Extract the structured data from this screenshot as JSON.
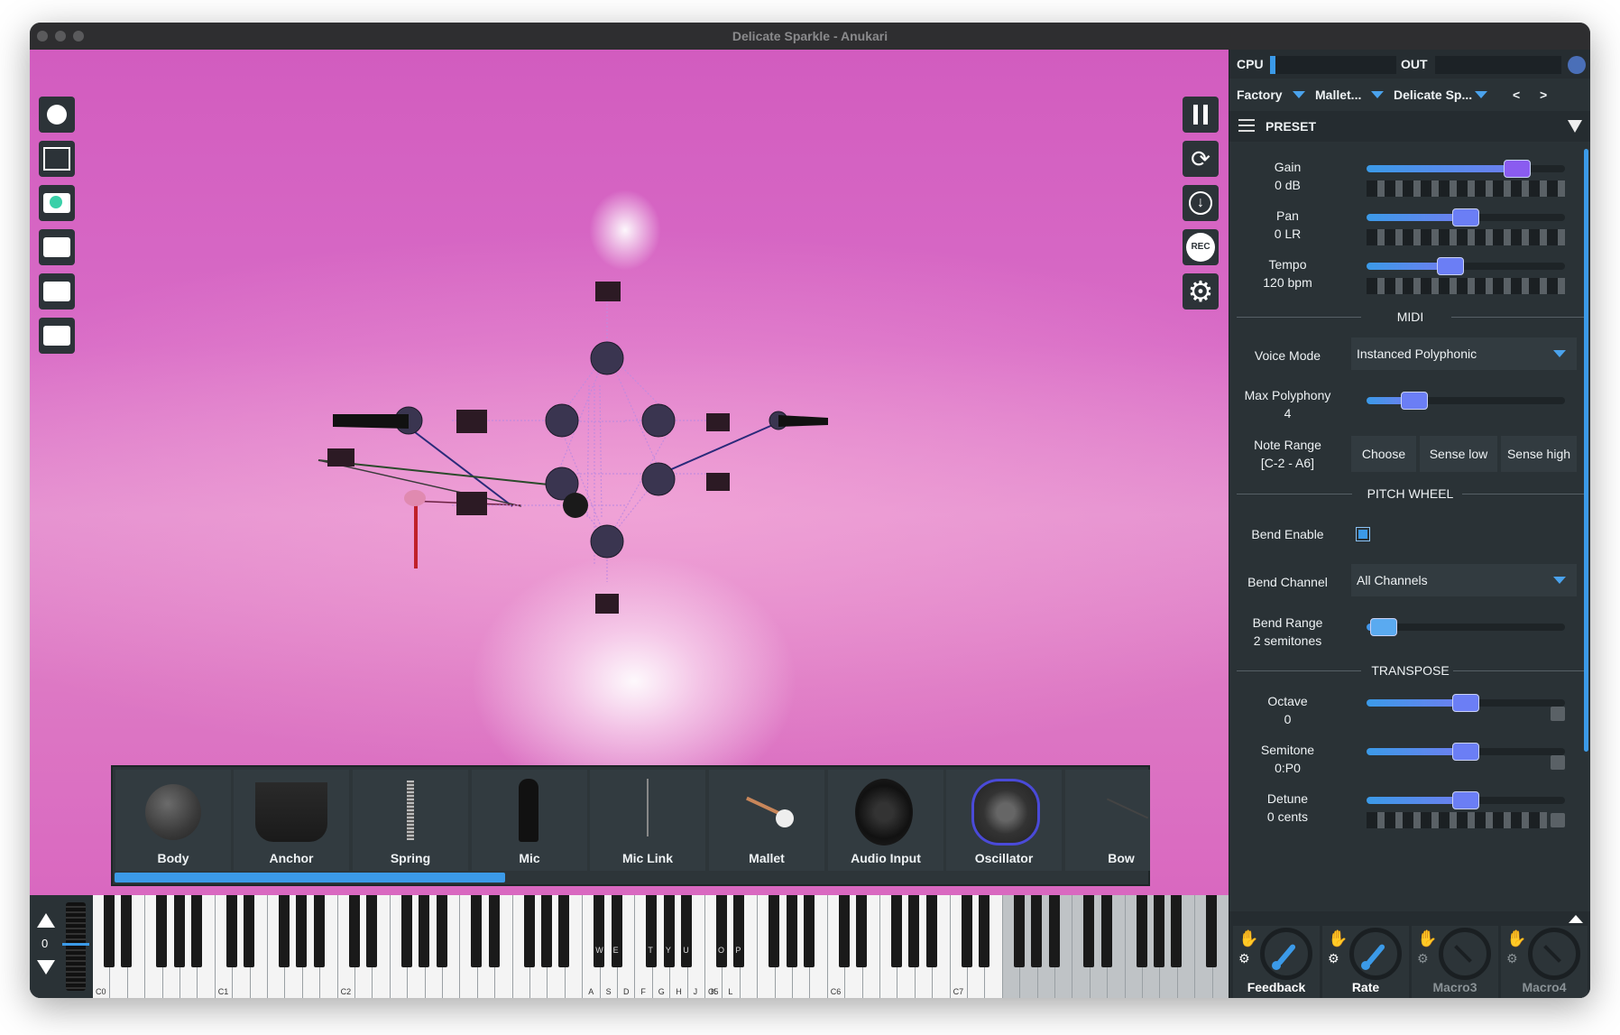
{
  "window": {
    "title": "Delicate Sparkle - Anukari"
  },
  "palette": {
    "items": [
      {
        "label": "Body"
      },
      {
        "label": "Anchor"
      },
      {
        "label": "Spring"
      },
      {
        "label": "Mic"
      },
      {
        "label": "Mic Link"
      },
      {
        "label": "Mallet"
      },
      {
        "label": "Audio Input"
      },
      {
        "label": "Oscillator"
      },
      {
        "label": "Bow"
      }
    ]
  },
  "keyboard": {
    "octave_value": "0",
    "octave_labels": [
      "C0",
      "C1",
      "C2",
      "C5",
      "C6",
      "C7"
    ],
    "upper_letters": [
      "W",
      "E",
      "T",
      "Y",
      "U",
      "O",
      "P"
    ],
    "lower_letters": [
      "A",
      "S",
      "D",
      "F",
      "G",
      "H",
      "J",
      "K",
      "L"
    ]
  },
  "panel": {
    "cpu_label": "CPU",
    "out_label": "OUT",
    "preset_dropdowns": [
      "Factory",
      "Mallet...",
      "Delicate Sp..."
    ],
    "prev_label": "<",
    "next_label": ">",
    "section_title": "PRESET",
    "gain": {
      "name": "Gain",
      "value": "0 dB",
      "level": 0.8
    },
    "pan": {
      "name": "Pan",
      "value": "0 LR",
      "level": 0.5
    },
    "tempo": {
      "name": "Tempo",
      "value": "120 bpm",
      "level": 0.41
    },
    "midi_header": "MIDI",
    "voice_mode": {
      "label": "Voice Mode",
      "value": "Instanced Polyphonic"
    },
    "max_polyphony": {
      "name": "Max Polyphony",
      "value": "4",
      "level": 0.2
    },
    "note_range": {
      "name": "Note Range",
      "value": "[C-2 - A6]",
      "choose": "Choose",
      "sense_low": "Sense low",
      "sense_high": "Sense high"
    },
    "pitch_header": "PITCH WHEEL",
    "bend_enable": {
      "label": "Bend Enable",
      "checked": true
    },
    "bend_channel": {
      "label": "Bend Channel",
      "value": "All Channels"
    },
    "bend_range": {
      "name": "Bend Range",
      "value": "2 semitones",
      "level": 0.02
    },
    "transpose_header": "TRANSPOSE",
    "octave": {
      "name": "Octave",
      "value": "0",
      "level": 0.5
    },
    "semitone": {
      "name": "Semitone",
      "value": "0:P0",
      "level": 0.5
    },
    "detune": {
      "name": "Detune",
      "value": "0 cents",
      "level": 0.5
    },
    "macros": [
      {
        "label": "Feedback",
        "active": true
      },
      {
        "label": "Rate",
        "active": true
      },
      {
        "label": "Macro3",
        "active": false
      },
      {
        "label": "Macro4",
        "active": false
      }
    ]
  },
  "colors": {
    "accent": "#3b9ae8",
    "thumb": "#6b7ef5",
    "gain_thumb": "#8a5cf0",
    "panel_bg": "#2a3236"
  }
}
